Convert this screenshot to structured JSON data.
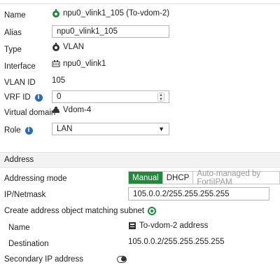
{
  "name": {
    "label": "Name",
    "value": "npu0_vlink1_105 (To-vdom-2)",
    "icon": "vlan-icon-green"
  },
  "alias": {
    "label": "Alias",
    "value": "npu0_vlink1_105"
  },
  "type": {
    "label": "Type",
    "value": "VLAN",
    "icon": "vlan-icon"
  },
  "interface": {
    "label": "Interface",
    "value": "npu0_vlink1",
    "icon": "port-icon"
  },
  "vlan_id": {
    "label": "VLAN ID",
    "value": "105"
  },
  "vrf_id": {
    "label": "VRF ID",
    "value": "0"
  },
  "virtual_domain": {
    "label": "Virtual domain",
    "value": "Vdom-4",
    "icon": "vdom-icon"
  },
  "role": {
    "label": "Role",
    "value": "LAN"
  },
  "address_section": {
    "title": "Address"
  },
  "addressing_mode": {
    "label": "Addressing mode",
    "options": [
      "Manual",
      "DHCP",
      "Auto-managed by FortiIPAM"
    ],
    "selected": "Manual"
  },
  "ip_netmask": {
    "label": "IP/Netmask",
    "value": "105.0.0.2/255.255.255.255"
  },
  "create_subnet": {
    "label": "Create address object matching subnet",
    "enabled": true
  },
  "subnet_name": {
    "label": "Name",
    "value": "To-vdom-2 address",
    "icon": "address-icon"
  },
  "destination": {
    "label": "Destination",
    "value": "105.0.0.2/255.255.255.255"
  },
  "secondary_ip": {
    "label": "Secondary IP address",
    "enabled": false
  },
  "colors": {
    "accent": "#1e8a3c",
    "info": "#2a6db5"
  }
}
